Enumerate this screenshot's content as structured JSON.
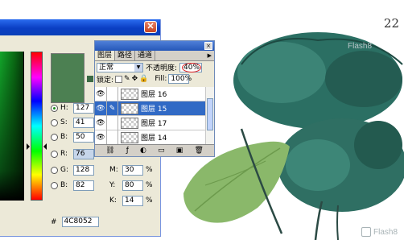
{
  "artwork": {
    "page_number": "22",
    "watermark_top": "Flash8",
    "watermark_bottom": "Flash8"
  },
  "picker": {
    "close_symbol": "✕",
    "swatch_color": "#4c8052",
    "h": {
      "label": "H:",
      "value": "127",
      "unit": "度"
    },
    "s": {
      "label": "S:",
      "value": "41",
      "unit": "%"
    },
    "b": {
      "label": "B:",
      "value": "50",
      "unit": "%"
    },
    "r": {
      "label": "R:",
      "value": "76"
    },
    "g": {
      "label": "G:",
      "value": "128"
    },
    "bb": {
      "label": "B:",
      "value": "82"
    },
    "m": {
      "label": "M:",
      "value": "30",
      "unit": "%"
    },
    "y": {
      "label": "Y:",
      "value": "80",
      "unit": "%"
    },
    "k": {
      "label": "K:",
      "value": "14",
      "unit": "%"
    },
    "hex_label": "#",
    "hex": "4C8052"
  },
  "layers_panel": {
    "close_symbol": "×",
    "tabs": [
      "图层",
      "路径",
      "通道"
    ],
    "menu_arrow": "▶",
    "blend_mode": "正常",
    "opacity_label": "不透明度:",
    "opacity_value": "40%",
    "lock_label": "锁定:",
    "fill_label": "Fill:",
    "fill_value": "100%",
    "layers": [
      {
        "name": "图层 16"
      },
      {
        "name": "图层 15"
      },
      {
        "name": "图层 17"
      },
      {
        "name": "图层 14"
      }
    ],
    "eye_icon": "👁",
    "brush_icon": "✎",
    "bottom_icons": [
      "⛓",
      "ƒ",
      "◐",
      "▭",
      "▣",
      "🗑"
    ]
  }
}
